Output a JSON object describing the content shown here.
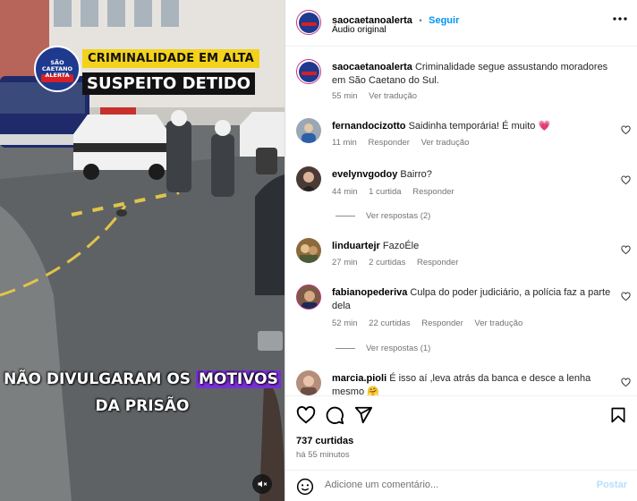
{
  "media": {
    "logo_text": [
      "SÃO CAETANO",
      "ALERTA"
    ],
    "tag_top": "CRIMINALIDADE EM ALTA",
    "tag_bottom": "SUSPEITO DETIDO",
    "caption_line1_pre": "NÃO DIVULGARAM OS",
    "caption_line1_highlight": "MOTIVOS",
    "caption_line2": "DA PRISÃO",
    "mute_icon": "speaker-muted-icon"
  },
  "header": {
    "username": "saocaetanoalerta",
    "separator": "•",
    "follow_label": "Seguir",
    "audio_label": "Áudio original",
    "more_icon": "more-options-icon"
  },
  "caption_post": {
    "username": "saocaetanoalerta",
    "text": "Criminalidade segue assustando moradores em São Caetano do Sul.",
    "time": "55 min",
    "translate": "Ver tradução"
  },
  "comments": [
    {
      "username": "fernandocizotto",
      "text": "Saidinha temporária! É muito",
      "emoji": "💗",
      "time": "11 min",
      "likes": "",
      "reply": "Responder",
      "translate": "Ver tradução",
      "view_replies": ""
    },
    {
      "username": "evelynvgodoy",
      "text": "Bairro?",
      "emoji": "",
      "time": "44 min",
      "likes": "1 curtida",
      "reply": "Responder",
      "translate": "",
      "view_replies": "Ver respostas (2)"
    },
    {
      "username": "linduartejr",
      "text": "FazoÉle",
      "emoji": "",
      "time": "27 min",
      "likes": "2 curtidas",
      "reply": "Responder",
      "translate": "",
      "view_replies": ""
    },
    {
      "username": "fabianopederiva",
      "text": "Culpa do poder judiciário, a polícia faz a parte dela",
      "emoji": "",
      "time": "52 min",
      "likes": "22 curtidas",
      "reply": "Responder",
      "translate": "Ver tradução",
      "view_replies": "Ver respostas (1)"
    },
    {
      "username": "marcia.pioli",
      "text": "É isso aí ,leva atrás da banca e desce a lenha mesmo",
      "emoji": "🤗",
      "time": "",
      "likes": "",
      "reply": "",
      "translate": "",
      "view_replies": ""
    }
  ],
  "actions": {
    "like_icon": "heart-icon",
    "comment_icon": "comment-icon",
    "share_icon": "send-icon",
    "save_icon": "bookmark-icon",
    "likes_count": "737 curtidas",
    "post_time": "há 55 minutos",
    "emoji_icon": "emoji-icon",
    "comment_placeholder": "Adicione um comentário...",
    "post_label": "Postar"
  },
  "colors": {
    "accent_blue": "#0095f6",
    "tag_yellow": "#f3d21b",
    "highlight_purple": "#7a2ed6",
    "heart_pink": "#e8457c"
  }
}
